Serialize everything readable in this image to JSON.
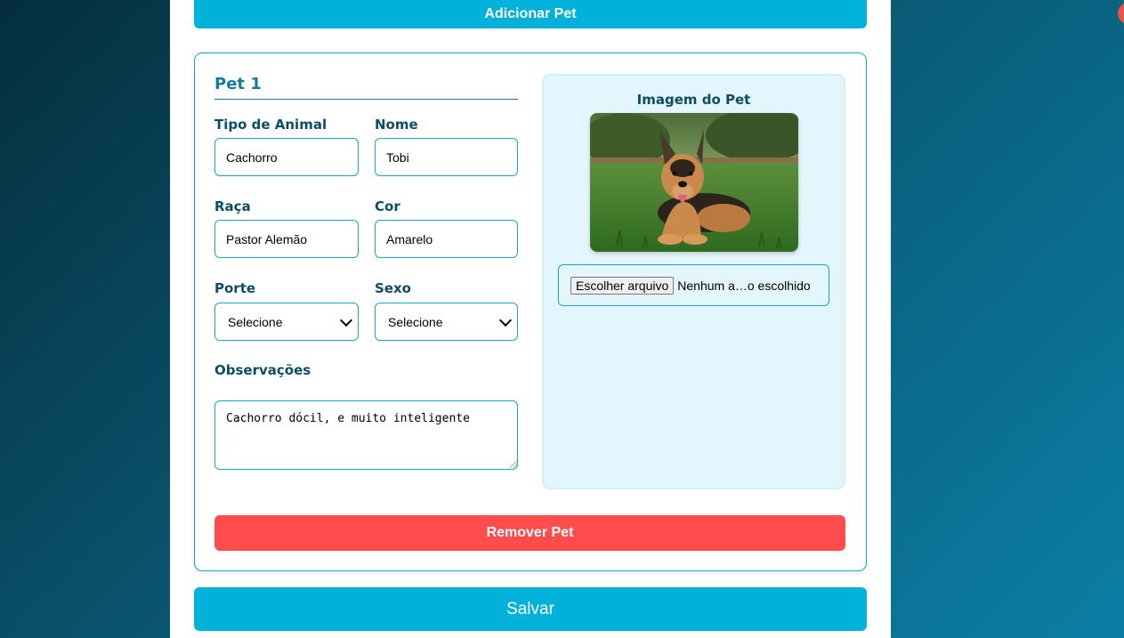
{
  "actions": {
    "add_pet_label": "Adicionar Pet",
    "remove_pet_label": "Remover Pet",
    "save_label": "Salvar"
  },
  "pet": {
    "title": "Pet 1",
    "fields": {
      "tipo": {
        "label": "Tipo de Animal",
        "value": "Cachorro"
      },
      "nome": {
        "label": "Nome",
        "value": "Tobi"
      },
      "raca": {
        "label": "Raça",
        "value": "Pastor Alemão"
      },
      "cor": {
        "label": "Cor",
        "value": "Amarelo"
      },
      "porte": {
        "label": "Porte",
        "selected": "Selecione"
      },
      "sexo": {
        "label": "Sexo",
        "selected": "Selecione"
      },
      "observacoes": {
        "label": "Observações",
        "value": "Cachorro dócil, e muito inteligente"
      }
    },
    "image": {
      "title": "Imagem do Pet",
      "file_button_label": "Escolher arquivo",
      "file_status": "Nenhum a…o escolhido"
    }
  },
  "colors": {
    "primary": "#00b2d9",
    "danger": "#ff4d4d",
    "label": "#0d4d63",
    "panel": "#e3f6fd"
  }
}
